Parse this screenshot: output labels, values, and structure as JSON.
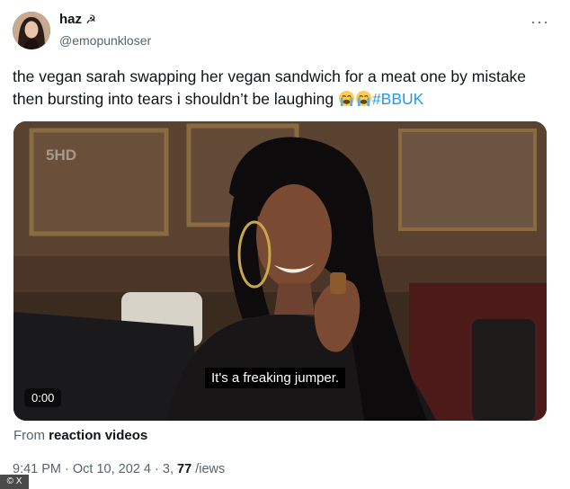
{
  "tweet": {
    "display_name": "haz",
    "name_icon": "hammer-and-sickle-icon",
    "name_icon_glyph": "☭",
    "handle": "@emopunkloser",
    "more_icon": "more-options-icon",
    "more_glyph": "···",
    "text": "the vegan sarah swapping her vegan sandwich for a meat one by mistake then bursting into tears i shouldn’t be laughing",
    "emojis": [
      "loudly-crying-face-icon",
      "loudly-crying-face-icon"
    ],
    "hashtag": "#BBUK"
  },
  "video": {
    "channel_logo": "5HD",
    "subtitle": "It's a freaking jumper.",
    "time": "0:00"
  },
  "attribution": {
    "prefix": "From",
    "source": "reaction videos"
  },
  "meta": {
    "time": "9:41 PM",
    "separator": "·",
    "date": "Oct 10, 20",
    "date_obscured": "2 4",
    "separator2": "·",
    "views_count": "77",
    "views_partial_prefix": "3,",
    "views_label": "/iews"
  },
  "corner_badge": "© X",
  "colors": {
    "accent": "#1d9bf0",
    "text": "#0f1419",
    "secondary": "#536471"
  }
}
